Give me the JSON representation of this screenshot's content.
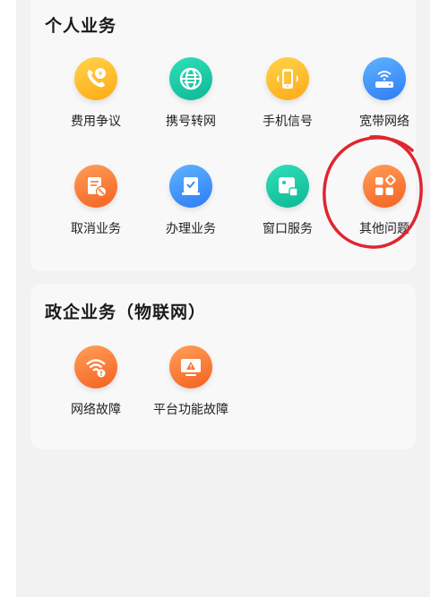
{
  "personal": {
    "title": "个人业务",
    "items": [
      {
        "label": "费用争议",
        "icon": "yuan-phone-icon"
      },
      {
        "label": "携号转网",
        "icon": "globe-transfer-icon"
      },
      {
        "label": "手机信号",
        "icon": "mobile-signal-icon"
      },
      {
        "label": "宽带网络",
        "icon": "router-wifi-icon"
      },
      {
        "label": "取消业务",
        "icon": "cancel-document-icon"
      },
      {
        "label": "办理业务",
        "icon": "checklist-icon"
      },
      {
        "label": "窗口服务",
        "icon": "window-service-icon"
      },
      {
        "label": "其他问题",
        "icon": "four-squares-icon"
      }
    ]
  },
  "enterprise": {
    "title": "政企业务（物联网）",
    "items": [
      {
        "label": "网络故障",
        "icon": "wifi-alert-icon"
      },
      {
        "label": "平台功能故障",
        "icon": "monitor-alert-icon"
      }
    ]
  },
  "colors": {
    "yellow": "#ffb822",
    "green": "#1cc9a4",
    "blue": "#3d8cf8",
    "orange": "#f8762f",
    "annotation_red": "#e0252e"
  }
}
